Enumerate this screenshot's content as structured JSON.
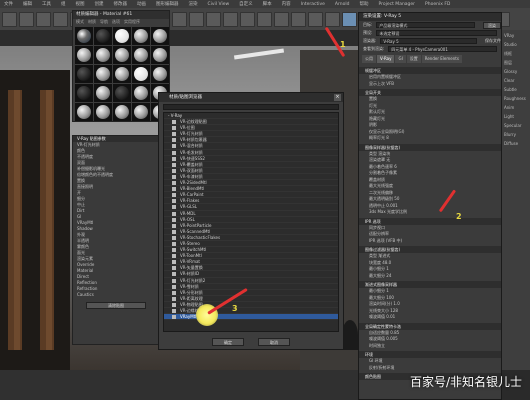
{
  "menubar": [
    "文件",
    "编辑",
    "工具",
    "组",
    "视图",
    "创建",
    "修改器",
    "动画",
    "图形编辑器",
    "渲染",
    "Civil View",
    "自定义",
    "脚本",
    "内容",
    "Interactive",
    "Arnold",
    "帮助",
    "Project Manager",
    "Phoenix FD"
  ],
  "material_editor": {
    "title": "材质编辑器 - Material #61",
    "menu": [
      "模式",
      "材质",
      "导航",
      "选项",
      "实用程序"
    ]
  },
  "left_panel": {
    "header": "V-Ray 贴图参数",
    "rows": [
      "VR-灯光材质",
      "颜色",
      "不透明度",
      "双面",
      "补偿摄影机曝光",
      "倍增颜色的不透明度",
      "置换",
      "直接照明",
      "开",
      "细分",
      "中止",
      "Dirt",
      "GI",
      "VRayMtl",
      "Shadow",
      "外观",
      "半透明",
      "雾颜色",
      "面光",
      "渲染元素",
      "Override",
      "Material",
      "Direct",
      "Reflection",
      "Refraction",
      "Caustics"
    ],
    "button": "清除贴图"
  },
  "browser": {
    "title": "材质/贴图浏览器",
    "category": "- V-Ray",
    "items": [
      "VR-边纹理贴图",
      "VR-位图",
      "VR-灯光材质",
      "VR-材质包裹器",
      "VR-混合材质",
      "VR-毛发材质",
      "VR-快速SSS2",
      "VR-覆盖材质",
      "VR-双面材质",
      "VR-车漆材质",
      "VR-2SidedMtl",
      "VR-BlendMtl",
      "VR-CarPaint",
      "VR-Flakes",
      "VR-GLSL",
      "VR-MDL",
      "VR-OSL",
      "VR-PointParticle",
      "VR-ScannedMtl",
      "VR-StochasticFlakes",
      "VR-Stereo",
      "VR-SwitchMtl",
      "VR-ToonMtl",
      "VR-VRmat",
      "VR-矢量置换",
      "VR-材质ID",
      "VR-灯光材质2",
      "VR-雪材质",
      "VR-分形材质",
      "VR-距离纹理",
      "VR-物理贴图",
      "VR-边缘纹理",
      "VRayMtl"
    ],
    "selected_index": 32,
    "ok": "确定",
    "cancel": "取消"
  },
  "render_setup": {
    "title": "渲染设置: V-Ray 5",
    "target_label": "目标:",
    "target_value": "产品级渲染模式",
    "preset_label": "预设:",
    "preset_value": "未选定预设",
    "renderer_label": "渲染器:",
    "renderer_value": "V-Ray 5",
    "save_label": "保存文件",
    "view_label": "查看到渲染:",
    "view_value": "四元菜单 4 - PhysCamera001",
    "render_button": "渲染",
    "tabs": [
      "公用",
      "V-Ray",
      "GI",
      "设置",
      "Render Elements"
    ],
    "active_tab": "V-Ray",
    "sections": [
      {
        "title": "帧缓冲区",
        "params": [
          "启用内置帧缓冲区",
          "显示上次 VFB"
        ]
      },
      {
        "title": "全局开关",
        "params": [
          "置换",
          "灯光",
          "默认灯光",
          "隐藏灯光",
          "阴影",
          "仅显示全局照明(GI)",
          "概率灯光 8"
        ]
      },
      {
        "title": "图像采样器(抗锯齿)",
        "params": [
          "类型 渲染块",
          "渲染遮罩 无",
          "最小着色速率 6",
          "分割着色子像素",
          "覆盖材质",
          "最大光线强度",
          "二次光线偏移",
          "最大透明级别 50",
          "透明中止 0.001",
          "3ds Max 光度学比例"
        ]
      },
      {
        "title": "IPR 选项",
        "params": [
          "同步视口",
          "适配分辨率",
          "IPR 选项 (VFB 中)"
        ]
      },
      {
        "title": "图像过滤器(抗锯齿)",
        "params": [
          "类型 渐进式",
          "块宽度 48.0",
          "最小细分 1",
          "最大细分 24"
        ]
      },
      {
        "title": "渐进式图像采样器",
        "params": [
          "最小细分 1",
          "最大细分 100",
          "渲染时间(分) 1.0",
          "光线束大小 128",
          "噪波阈值 0.01"
        ]
      },
      {
        "title": "全局确定性蒙特卡洛",
        "params": [
          "自适应数量 0.85",
          "噪波阈值 0.005",
          "时间独立"
        ]
      },
      {
        "title": "环境",
        "params": [
          "GI 环境",
          "反射/折射环境"
        ]
      },
      {
        "title": "颜色贴图",
        "params": []
      }
    ]
  },
  "command_panel": {
    "rows": [
      "VRay",
      "Studio",
      "线框",
      "图层",
      "Glossy",
      "Clear",
      "Subtle",
      "Roughness",
      "Anim",
      "Light",
      "Specular",
      "Blurry",
      "Diffuse"
    ]
  },
  "annotations": {
    "step1": "1",
    "step2": "2",
    "step3": "3"
  },
  "watermark": "百家号/非知名银儿士"
}
